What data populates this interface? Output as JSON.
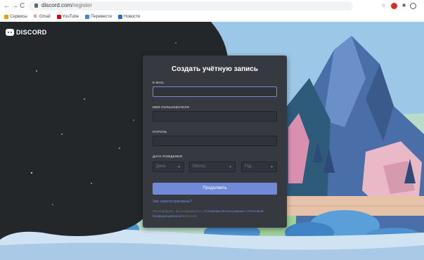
{
  "browser": {
    "url_domain": "discord.com",
    "url_path": "/register",
    "nav": {
      "back": "←",
      "forward": "→",
      "reload": "C"
    },
    "bookmarks": [
      {
        "label": "Сервисы",
        "color": "#e0a000"
      },
      {
        "label": "Gmail",
        "color": "#e04030",
        "prefix": "G"
      },
      {
        "label": "YouTube",
        "color": "#e00000"
      },
      {
        "label": "Перевести",
        "color": "#4a7fd8"
      },
      {
        "label": "Новости",
        "color": "#3366cc"
      }
    ],
    "toolbar_icons": [
      "star-icon",
      "adblock-icon",
      "extension-icon",
      "profile-icon"
    ]
  },
  "brand": {
    "name": "DISCORD"
  },
  "form": {
    "title": "Создать учётную запись",
    "email_label": "E-MAIL",
    "email_value": "",
    "username_label": "ИМЯ ПОЛЬЗОВАТЕЛЯ",
    "username_value": "",
    "password_label": "ПАРОЛЬ",
    "password_value": "",
    "dob_label": "ДАТА РОЖДЕНИЯ",
    "dob_day": "День",
    "dob_month": "Месяц",
    "dob_year": "Год",
    "submit_label": "Продолжить",
    "login_link": "Уже зарегистрированы?",
    "tos_prefix": "Регистрируясь, вы соглашаетесь с",
    "tos_link1": "Условиями Использования",
    "tos_and": "и",
    "tos_link2": "Политикой Конфиденциальности",
    "tos_suffix": "Discord."
  },
  "colors": {
    "accent": "#7289da",
    "card": "#36393f",
    "input": "#303339"
  }
}
